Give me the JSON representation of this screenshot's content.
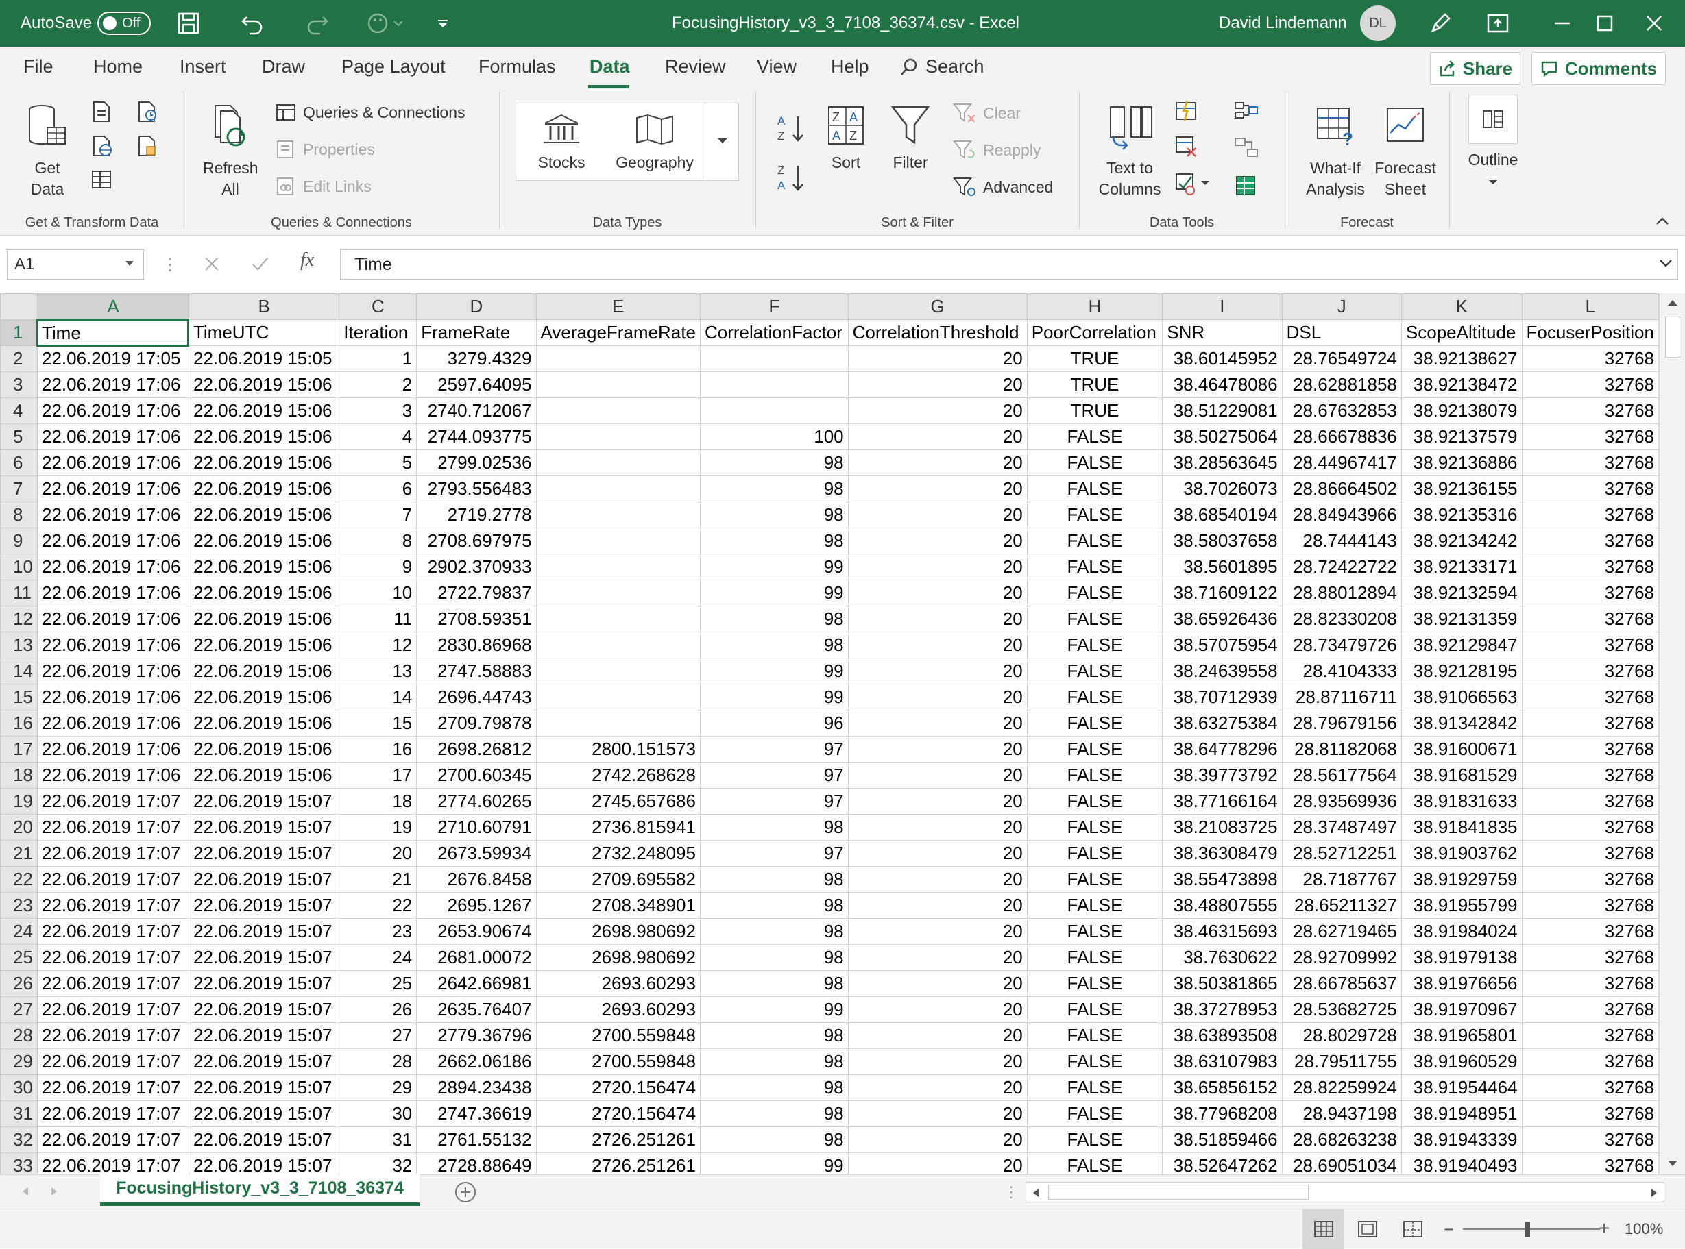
{
  "titlebar": {
    "autosave_label": "AutoSave",
    "autosave_state": "Off",
    "title": "FocusingHistory_v3_3_7108_36374.csv  -  Excel",
    "user": "David Lindemann",
    "initials": "DL"
  },
  "menu": {
    "tabs": [
      "File",
      "Home",
      "Insert",
      "Draw",
      "Page Layout",
      "Formulas",
      "Data",
      "Review",
      "View",
      "Help"
    ],
    "search": "Search",
    "share": "Share",
    "comments": "Comments"
  },
  "ribbon": {
    "get_data": "Get Data",
    "refresh_all": "Refresh All",
    "queries_connections": "Queries & Connections",
    "properties": "Properties",
    "edit_links": "Edit Links",
    "stocks": "Stocks",
    "geography": "Geography",
    "sort": "Sort",
    "filter": "Filter",
    "clear": "Clear",
    "reapply": "Reapply",
    "advanced": "Advanced",
    "text_to_columns": "Text to Columns",
    "what_if": "What-If Analysis",
    "forecast_sheet": "Forecast Sheet",
    "outline": "Outline",
    "groups": {
      "get_transform": "Get & Transform Data",
      "queries": "Queries & Connections",
      "data_types": "Data Types",
      "sort_filter": "Sort & Filter",
      "data_tools": "Data Tools",
      "forecast": "Forecast"
    }
  },
  "formula_bar": {
    "name_box": "A1",
    "content": "Time"
  },
  "sheet": {
    "columns": [
      "A",
      "B",
      "C",
      "D",
      "E",
      "F",
      "G",
      "H",
      "I",
      "J",
      "K",
      "L"
    ],
    "headers": [
      "Time",
      "TimeUTC",
      "Iteration",
      "FrameRate",
      "AverageFrameRate",
      "CorrelationFactor",
      "CorrelationThreshold",
      "PoorCorrelation",
      "SNR",
      "DSL",
      "ScopeAltitude",
      "FocuserPosition"
    ],
    "rows": [
      [
        "22.06.2019 17:05",
        "22.06.2019 15:05",
        "1",
        "3279.4329",
        "",
        "",
        "20",
        "TRUE",
        "38.60145952",
        "28.76549724",
        "38.92138627",
        "32768"
      ],
      [
        "22.06.2019 17:06",
        "22.06.2019 15:06",
        "2",
        "2597.64095",
        "",
        "",
        "20",
        "TRUE",
        "38.46478086",
        "28.62881858",
        "38.92138472",
        "32768"
      ],
      [
        "22.06.2019 17:06",
        "22.06.2019 15:06",
        "3",
        "2740.712067",
        "",
        "",
        "20",
        "TRUE",
        "38.51229081",
        "28.67632853",
        "38.92138079",
        "32768"
      ],
      [
        "22.06.2019 17:06",
        "22.06.2019 15:06",
        "4",
        "2744.093775",
        "",
        "100",
        "20",
        "FALSE",
        "38.50275064",
        "28.66678836",
        "38.92137579",
        "32768"
      ],
      [
        "22.06.2019 17:06",
        "22.06.2019 15:06",
        "5",
        "2799.02536",
        "",
        "98",
        "20",
        "FALSE",
        "38.28563645",
        "28.44967417",
        "38.92136886",
        "32768"
      ],
      [
        "22.06.2019 17:06",
        "22.06.2019 15:06",
        "6",
        "2793.556483",
        "",
        "98",
        "20",
        "FALSE",
        "38.7026073",
        "28.86664502",
        "38.92136155",
        "32768"
      ],
      [
        "22.06.2019 17:06",
        "22.06.2019 15:06",
        "7",
        "2719.2778",
        "",
        "98",
        "20",
        "FALSE",
        "38.68540194",
        "28.84943966",
        "38.92135316",
        "32768"
      ],
      [
        "22.06.2019 17:06",
        "22.06.2019 15:06",
        "8",
        "2708.697975",
        "",
        "98",
        "20",
        "FALSE",
        "38.58037658",
        "28.7444143",
        "38.92134242",
        "32768"
      ],
      [
        "22.06.2019 17:06",
        "22.06.2019 15:06",
        "9",
        "2902.370933",
        "",
        "99",
        "20",
        "FALSE",
        "38.5601895",
        "28.72422722",
        "38.92133171",
        "32768"
      ],
      [
        "22.06.2019 17:06",
        "22.06.2019 15:06",
        "10",
        "2722.79837",
        "",
        "99",
        "20",
        "FALSE",
        "38.71609122",
        "28.88012894",
        "38.92132594",
        "32768"
      ],
      [
        "22.06.2019 17:06",
        "22.06.2019 15:06",
        "11",
        "2708.59351",
        "",
        "98",
        "20",
        "FALSE",
        "38.65926436",
        "28.82330208",
        "38.92131359",
        "32768"
      ],
      [
        "22.06.2019 17:06",
        "22.06.2019 15:06",
        "12",
        "2830.86968",
        "",
        "98",
        "20",
        "FALSE",
        "38.57075954",
        "28.73479726",
        "38.92129847",
        "32768"
      ],
      [
        "22.06.2019 17:06",
        "22.06.2019 15:06",
        "13",
        "2747.58883",
        "",
        "99",
        "20",
        "FALSE",
        "38.24639558",
        "28.4104333",
        "38.92128195",
        "32768"
      ],
      [
        "22.06.2019 17:06",
        "22.06.2019 15:06",
        "14",
        "2696.44743",
        "",
        "99",
        "20",
        "FALSE",
        "38.70712939",
        "28.87116711",
        "38.91066563",
        "32768"
      ],
      [
        "22.06.2019 17:06",
        "22.06.2019 15:06",
        "15",
        "2709.79878",
        "",
        "96",
        "20",
        "FALSE",
        "38.63275384",
        "28.79679156",
        "38.91342842",
        "32768"
      ],
      [
        "22.06.2019 17:06",
        "22.06.2019 15:06",
        "16",
        "2698.26812",
        "2800.151573",
        "97",
        "20",
        "FALSE",
        "38.64778296",
        "28.81182068",
        "38.91600671",
        "32768"
      ],
      [
        "22.06.2019 17:06",
        "22.06.2019 15:06",
        "17",
        "2700.60345",
        "2742.268628",
        "97",
        "20",
        "FALSE",
        "38.39773792",
        "28.56177564",
        "38.91681529",
        "32768"
      ],
      [
        "22.06.2019 17:07",
        "22.06.2019 15:07",
        "18",
        "2774.60265",
        "2745.657686",
        "97",
        "20",
        "FALSE",
        "38.77166164",
        "28.93569936",
        "38.91831633",
        "32768"
      ],
      [
        "22.06.2019 17:07",
        "22.06.2019 15:07",
        "19",
        "2710.60791",
        "2736.815941",
        "98",
        "20",
        "FALSE",
        "38.21083725",
        "28.37487497",
        "38.91841835",
        "32768"
      ],
      [
        "22.06.2019 17:07",
        "22.06.2019 15:07",
        "20",
        "2673.59934",
        "2732.248095",
        "97",
        "20",
        "FALSE",
        "38.36308479",
        "28.52712251",
        "38.91903762",
        "32768"
      ],
      [
        "22.06.2019 17:07",
        "22.06.2019 15:07",
        "21",
        "2676.8458",
        "2709.695582",
        "98",
        "20",
        "FALSE",
        "38.55473898",
        "28.7187767",
        "38.91929759",
        "32768"
      ],
      [
        "22.06.2019 17:07",
        "22.06.2019 15:07",
        "22",
        "2695.1267",
        "2708.348901",
        "98",
        "20",
        "FALSE",
        "38.48807555",
        "28.65211327",
        "38.91955799",
        "32768"
      ],
      [
        "22.06.2019 17:07",
        "22.06.2019 15:07",
        "23",
        "2653.90674",
        "2698.980692",
        "98",
        "20",
        "FALSE",
        "38.46315693",
        "28.62719465",
        "38.91984024",
        "32768"
      ],
      [
        "22.06.2019 17:07",
        "22.06.2019 15:07",
        "24",
        "2681.00072",
        "2698.980692",
        "98",
        "20",
        "FALSE",
        "38.7630622",
        "28.92709992",
        "38.91979138",
        "32768"
      ],
      [
        "22.06.2019 17:07",
        "22.06.2019 15:07",
        "25",
        "2642.66981",
        "2693.60293",
        "98",
        "20",
        "FALSE",
        "38.50381865",
        "28.66785637",
        "38.91976656",
        "32768"
      ],
      [
        "22.06.2019 17:07",
        "22.06.2019 15:07",
        "26",
        "2635.76407",
        "2693.60293",
        "99",
        "20",
        "FALSE",
        "38.37278953",
        "28.53682725",
        "38.91970967",
        "32768"
      ],
      [
        "22.06.2019 17:07",
        "22.06.2019 15:07",
        "27",
        "2779.36796",
        "2700.559848",
        "98",
        "20",
        "FALSE",
        "38.63893508",
        "28.8029728",
        "38.91965801",
        "32768"
      ],
      [
        "22.06.2019 17:07",
        "22.06.2019 15:07",
        "28",
        "2662.06186",
        "2700.559848",
        "98",
        "20",
        "FALSE",
        "38.63107983",
        "28.79511755",
        "38.91960529",
        "32768"
      ],
      [
        "22.06.2019 17:07",
        "22.06.2019 15:07",
        "29",
        "2894.23438",
        "2720.156474",
        "98",
        "20",
        "FALSE",
        "38.65856152",
        "28.82259924",
        "38.91954464",
        "32768"
      ],
      [
        "22.06.2019 17:07",
        "22.06.2019 15:07",
        "30",
        "2747.36619",
        "2720.156474",
        "98",
        "20",
        "FALSE",
        "38.77968208",
        "28.9437198",
        "38.91948951",
        "32768"
      ],
      [
        "22.06.2019 17:07",
        "22.06.2019 15:07",
        "31",
        "2761.55132",
        "2726.251261",
        "98",
        "20",
        "FALSE",
        "38.51859466",
        "28.68263238",
        "38.91943339",
        "32768"
      ],
      [
        "22.06.2019 17:07",
        "22.06.2019 15:07",
        "32",
        "2728.88649",
        "2726.251261",
        "99",
        "20",
        "FALSE",
        "38.52647262",
        "28.69051034",
        "38.91940493",
        "32768"
      ]
    ]
  },
  "sheet_tab": "FocusingHistory_v3_3_7108_36374",
  "status": {
    "zoom": "100%"
  }
}
